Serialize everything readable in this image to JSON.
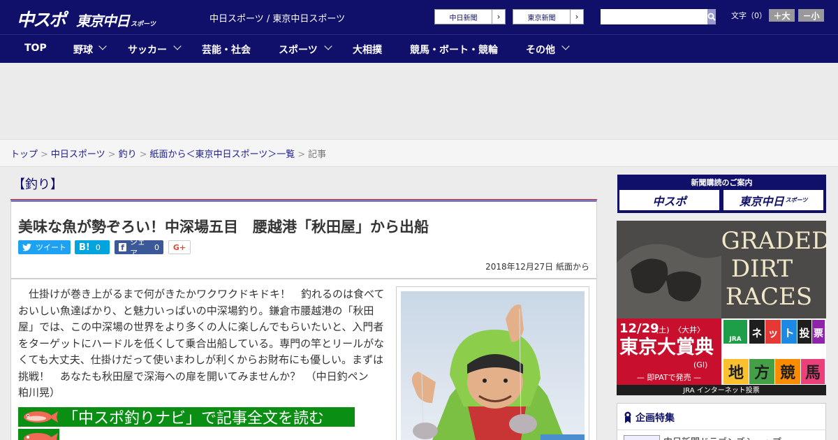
{
  "header": {
    "logo_chuspo": "中スポ",
    "logo_tokyo": "東京中日",
    "logo_sports": "スポーツ",
    "site_name": "中日スポーツ / 東京中日スポーツ",
    "ext_links": [
      {
        "label": "中日新聞",
        "arrow": "›"
      },
      {
        "label": "東京新聞",
        "arrow": "›"
      }
    ],
    "search_placeholder": "",
    "font_size_label": "文字（0）",
    "font_larger": "＋大",
    "font_smaller": "－小"
  },
  "nav": {
    "items": [
      {
        "label": "TOP"
      },
      {
        "label": "野球"
      },
      {
        "label": "サッカー"
      },
      {
        "label": "芸能・社会"
      },
      {
        "label": "スポーツ"
      },
      {
        "label": "大相撲"
      },
      {
        "label": "競馬・ボート・競輪"
      },
      {
        "label": "その他"
      }
    ]
  },
  "breadcrumb": {
    "items": [
      "トップ",
      "中日スポーツ",
      "釣り",
      "紙面から＜東京中日スポーツ＞一覧"
    ],
    "separator": ">",
    "current": "記事"
  },
  "article": {
    "category": "【釣り】",
    "title": "美味な魚が勢ぞろい！中深場五目　腰越港「秋田屋」から出船",
    "share": {
      "tweet": "ツイート",
      "hatena": "B!",
      "hatena_count": "0",
      "facebook": "シェア",
      "facebook_count": "0",
      "gplus": "G+"
    },
    "date": "2018年12月27日 紙面から",
    "lead": "　仕掛けが巻き上がるまで何がきたかワクワクドキドキ！　釣れるのは食べておいしい魚達ばかり、と魅力いっぱいの中深場釣り。鎌倉市腰越港の「秋田屋」では、この中深場の世界をより多くの人に楽しんでもらいたいと、入門者をターゲットにハードルを低くして乗合出船している。専門の竿とリールがなくても大丈夫、仕掛けだって使いまわしが利くからお財布にも優しい。まずは挑戦！　あなたも秋田屋で深海への扉を開いてみませんか？　（中日釣ペン　粕川晃）",
    "read_more": "「中スポ釣りナビ」で記事全文を読む"
  },
  "sidebar": {
    "subscribe_title": "新聞購読のご案内",
    "subscribe_chuspo": "中スポ",
    "subscribe_tokyo": "東京中日",
    "subscribe_tokyo_sub": "スポーツ",
    "banner": {
      "line1": "GRADED",
      "line2": "DIRT",
      "line3": "RACES",
      "date": "12/29",
      "dow": "(土)",
      "venue": "〈大井〉",
      "race": "東京大賞典",
      "grade": "(GI)",
      "pat": "— 即PATで発売 —",
      "jra": "JRA",
      "net_chars": [
        "ネ",
        "ッ",
        "ト",
        "投",
        "票"
      ],
      "chiho_chars": [
        "地",
        "方",
        "競",
        "馬"
      ],
      "jra_footer": "JRA インターネット投票"
    },
    "special_title": "企画特集",
    "special_item": "中日新聞ドラゴンズショップ"
  },
  "colors": {
    "brand_navy": "#10106a",
    "accent_red": "#d9283b",
    "readmore_green": "#0a8e14",
    "twitter": "#1da1f2",
    "hatena": "#00a4de",
    "facebook": "#3b5998"
  }
}
